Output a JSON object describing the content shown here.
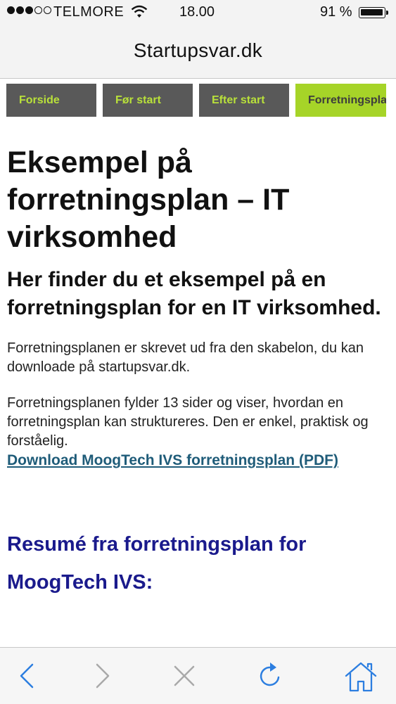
{
  "status_bar": {
    "carrier": "TELMORE",
    "time": "18.00",
    "battery_percent": "91 %",
    "signal_bars_filled": 3,
    "signal_bars_total": 5
  },
  "browser": {
    "site_title": "Startupsvar.dk"
  },
  "nav": {
    "tabs": [
      {
        "label": "Forside",
        "active": false
      },
      {
        "label": "Før start",
        "active": false
      },
      {
        "label": "Efter start",
        "active": false
      },
      {
        "label": "Forretningsplan",
        "active": true
      }
    ]
  },
  "content": {
    "heading": "Eksempel på forretningsplan – IT virksomhed",
    "subheading": "Her finder du et eksempel på en forretningsplan for en IT virksomhed.",
    "paragraph1": "Forretningsplanen er skrevet ud fra den skabelon, du kan downloade på startupsvar.dk.",
    "paragraph2": "Forretningsplanen fylder 13 sider og viser, hvordan en forretningsplan kan struktureres. Den er enkel, praktisk og forståelig.",
    "download_link": "Download MoogTech IVS forretningsplan  (PDF)",
    "section_heading": "Resumé fra forretningsplan for MoogTech IVS:"
  },
  "toolbar": {
    "icons": [
      "back-icon",
      "forward-icon",
      "stop-icon",
      "reload-icon",
      "home-icon"
    ]
  },
  "colors": {
    "tab_bg": "#595959",
    "tab_text": "#b9e13a",
    "tab_active_bg": "#a6d428",
    "link": "#1f5c79",
    "section_heading": "#1a1a8c",
    "ios_blue": "#2c7ee0"
  }
}
